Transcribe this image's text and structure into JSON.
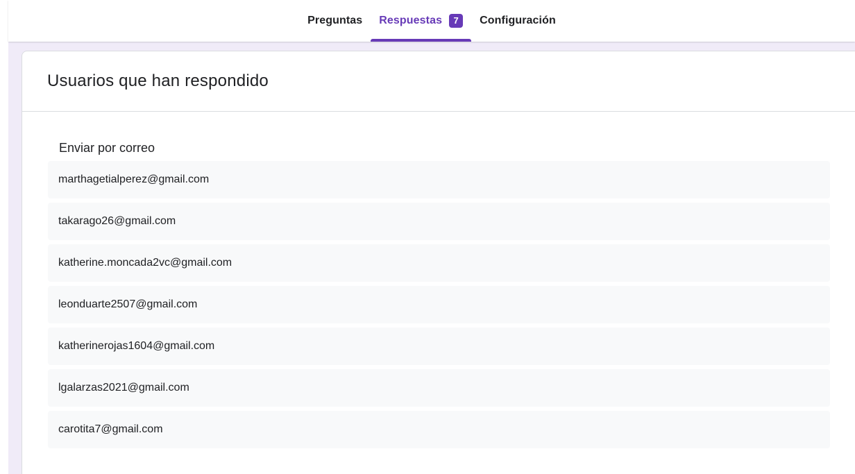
{
  "tabs": [
    {
      "label": "Preguntas",
      "active": false
    },
    {
      "label": "Respuestas",
      "active": true,
      "badge": "7"
    },
    {
      "label": "Configuración",
      "active": false
    }
  ],
  "card": {
    "title": "Usuarios que han respondido",
    "section_label": "Enviar por correo",
    "emails": [
      "marthagetialperez@gmail.com",
      "takarago26@gmail.com",
      "katherine.moncada2vc@gmail.com",
      "leonduarte2507@gmail.com",
      "katherinerojas1604@gmail.com",
      "lgalarzas2021@gmail.com",
      "carotita7@gmail.com"
    ]
  },
  "colors": {
    "accent": "#673ab7",
    "background": "#f0ebf8",
    "row_background": "#f8f9fa"
  }
}
